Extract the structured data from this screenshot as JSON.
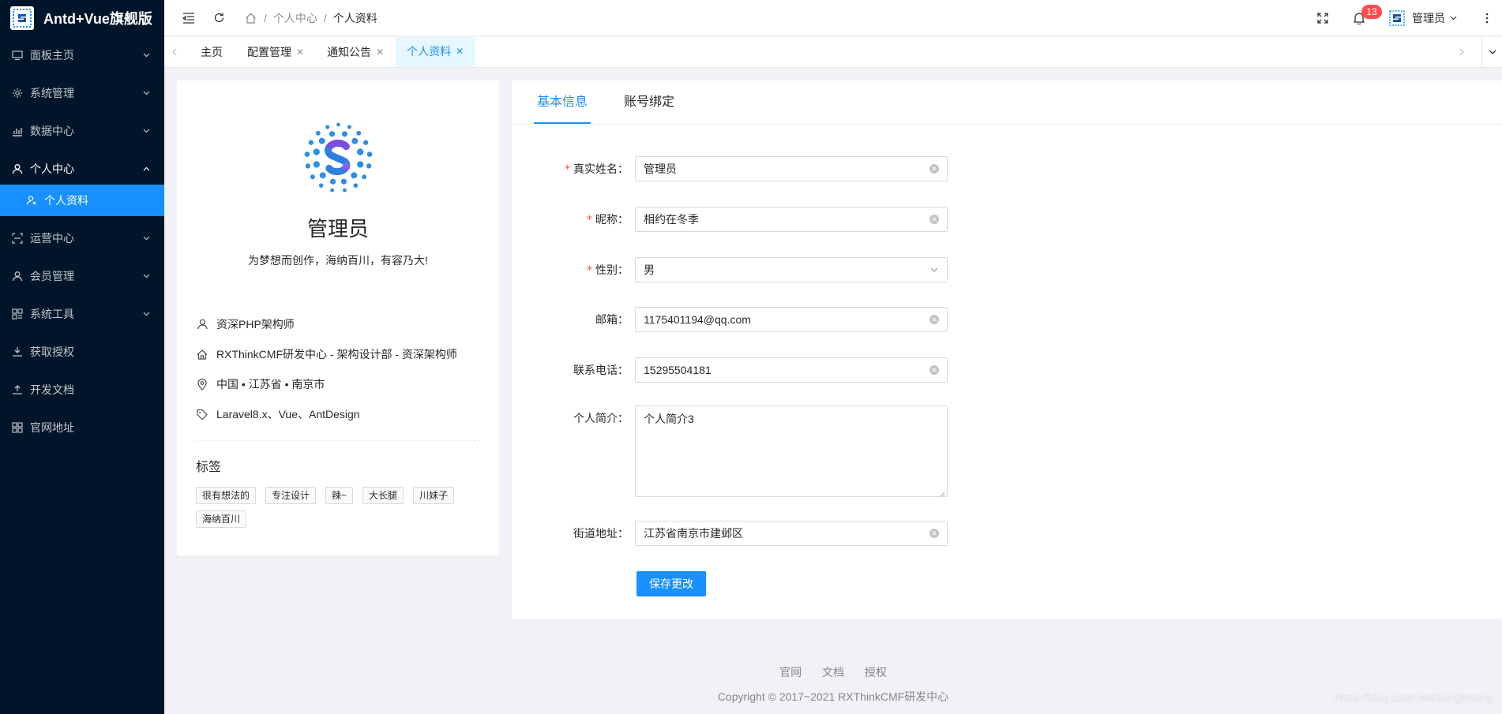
{
  "app": {
    "title": "Antd+Vue旗舰版"
  },
  "sidebar": {
    "items": [
      {
        "label": "面板主页",
        "icon": "monitor-icon"
      },
      {
        "label": "系统管理",
        "icon": "setting-icon"
      },
      {
        "label": "数据中心",
        "icon": "chart-icon"
      },
      {
        "label": "个人中心",
        "icon": "user-icon"
      },
      {
        "label": "个人资料",
        "icon": "user-profile-icon"
      },
      {
        "label": "运营中心",
        "icon": "scan-icon"
      },
      {
        "label": "会员管理",
        "icon": "user-icon"
      },
      {
        "label": "系统工具",
        "icon": "layout-icon"
      },
      {
        "label": "获取授权",
        "icon": "download-icon"
      },
      {
        "label": "开发文档",
        "icon": "upload-icon"
      },
      {
        "label": "官网地址",
        "icon": "appstore-icon"
      }
    ]
  },
  "header": {
    "breadcrumb": [
      "个人中心",
      "个人资料"
    ],
    "notification_count": "13",
    "user_name": "管理员"
  },
  "tabs": [
    {
      "label": "主页"
    },
    {
      "label": "配置管理"
    },
    {
      "label": "通知公告"
    },
    {
      "label": "个人资料"
    }
  ],
  "profile": {
    "name": "管理员",
    "signature": "为梦想而创作，海纳百川，有容乃大!",
    "title": "资深PHP架构师",
    "department": "RXThinkCMF研发中心 - 架构设计部 - 资深架构师",
    "location": "中国 • 江苏省 • 南京市",
    "skills": "Laravel8.x、Vue、AntDesign",
    "tags_title": "标签",
    "tags": [
      "很有想法的",
      "专注设计",
      "辣~",
      "大长腿",
      "川妹子",
      "海纳百川"
    ]
  },
  "form": {
    "tabs": [
      "基本信息",
      "账号绑定"
    ],
    "realname_label": "真实姓名",
    "realname_value": "管理员",
    "nickname_label": "昵称",
    "nickname_value": "相约在冬季",
    "gender_label": "性别",
    "gender_value": "男",
    "email_label": "邮箱",
    "email_value": "1175401194@qq.com",
    "phone_label": "联系电话",
    "phone_value": "15295504181",
    "intro_label": "个人简介",
    "intro_value": "个人简介3",
    "address_label": "街道地址",
    "address_value": "江苏省南京市建邺区",
    "colon": "：",
    "required_mark": "*",
    "save_label": "保存更改"
  },
  "footer": {
    "links": [
      "官网",
      "文档",
      "授权"
    ],
    "copyright": "Copyright © 2017~2021 RXThinkCMF研发中心"
  },
  "watermark": "https://blog.csdn.net/zongjinlong",
  "colors": {
    "primary": "#1890ff",
    "sider": "#001529",
    "danger": "#ff4d4f"
  }
}
